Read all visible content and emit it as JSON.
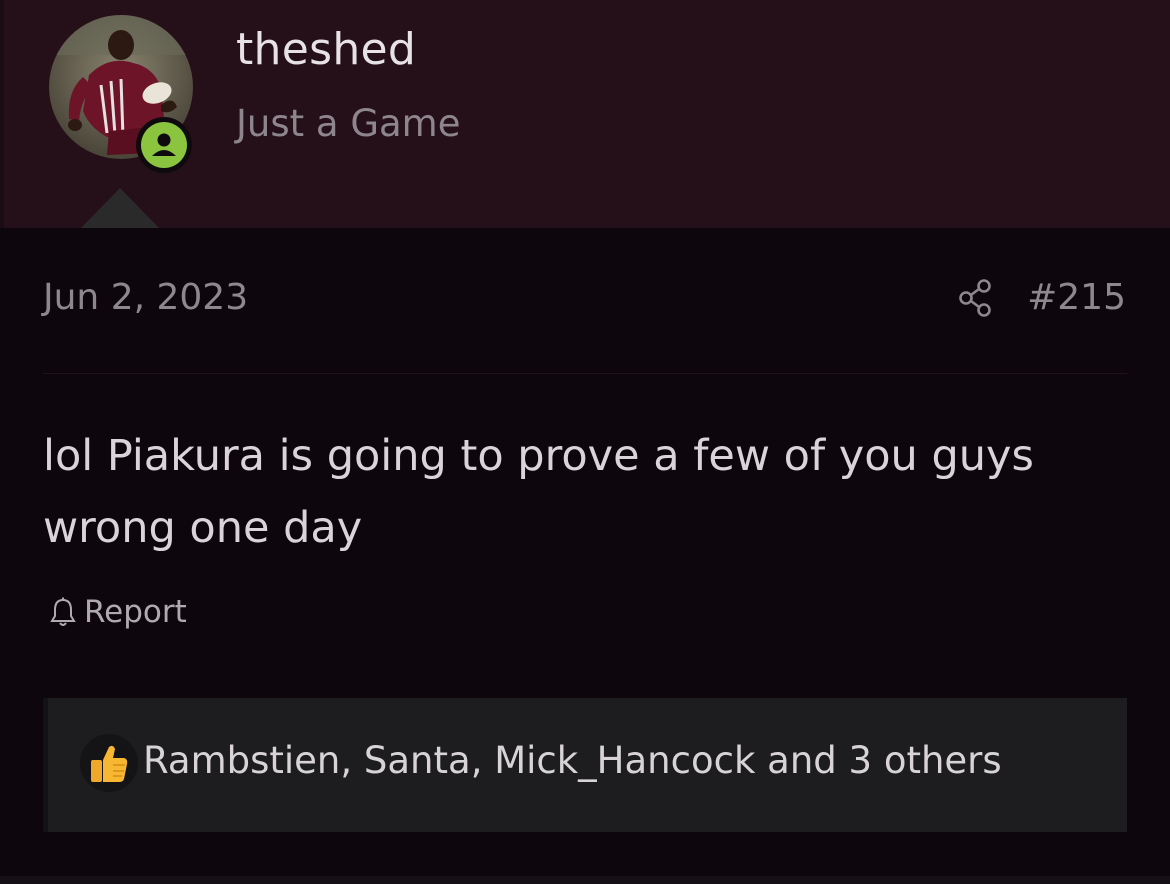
{
  "user": {
    "username": "theshed",
    "title": "Just a Game"
  },
  "avatar_icon": "user-avatar-photo",
  "status_icon": "online-user-icon",
  "colors": {
    "header_bg": "#251019",
    "post_bg": "#0d060c",
    "status_green": "#8bc53f"
  },
  "post": {
    "date": "Jun 2, 2023",
    "number": "#215",
    "share_icon": "share-icon",
    "body": "lol Piakura is going to prove a few of you guys wrong one day",
    "report_label": "Report",
    "report_icon": "bell-icon"
  },
  "reactions": {
    "icon": "thumbs-up-icon",
    "text": "Rambstien, Santa, Mick_Hancock and 3 others"
  }
}
